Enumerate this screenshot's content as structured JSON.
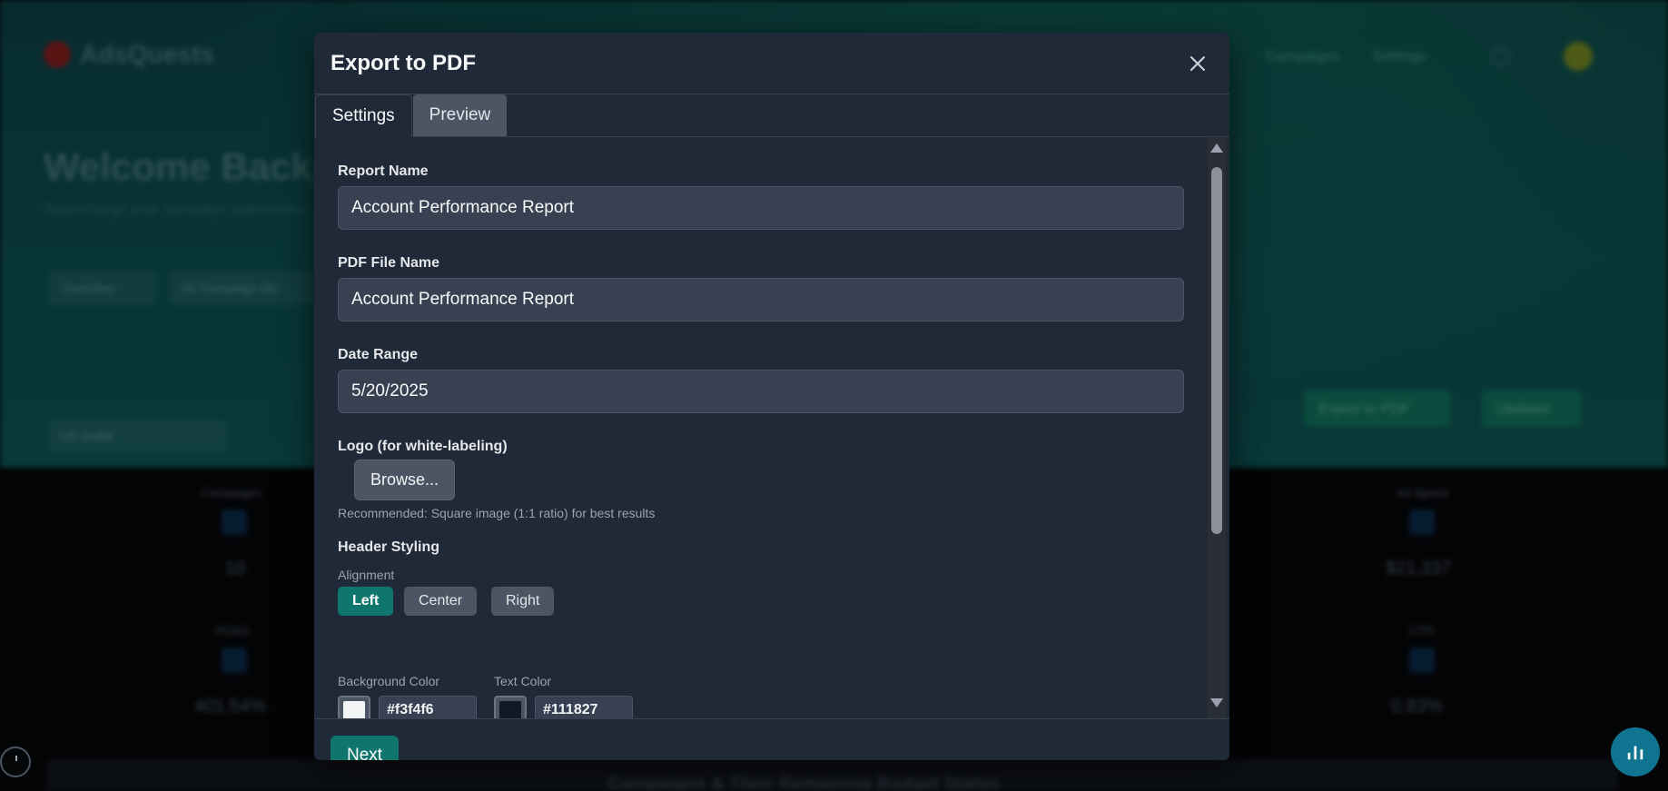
{
  "background": {
    "app_name": "AdsQuests",
    "nav": [
      "Campaigns",
      "Settings"
    ],
    "welcome": "Welcome Back,",
    "subtitle": "Supercharge your campaign optimization",
    "pills": [
      "Overview",
      "All Campaign Ids"
    ],
    "buttons": [
      "Export to PDF",
      "Updates"
    ],
    "filter": "US Dollar",
    "stats": [
      {
        "label": "Campaigns",
        "value": "10"
      },
      {
        "label": "Ad Spend",
        "value": "$21,337"
      },
      {
        "label": "ROAS",
        "value": "401.54%"
      },
      {
        "label": "CTR",
        "value": "0.83%"
      }
    ],
    "section_title": "Campaigns & Their Remaining Budget Status"
  },
  "modal": {
    "title": "Export to PDF",
    "tabs": [
      {
        "label": "Settings",
        "active": true
      },
      {
        "label": "Preview",
        "active": false
      }
    ],
    "fields": {
      "report_name_label": "Report Name",
      "report_name_value": "Account Performance Report",
      "pdf_file_name_label": "PDF File Name",
      "pdf_file_name_value": "Account Performance Report",
      "date_range_label": "Date Range",
      "date_range_value": "5/20/2025",
      "logo_label": "Logo (for white-labeling)",
      "browse_label": "Browse...",
      "logo_hint": "Recommended: Square image (1:1 ratio) for best results"
    },
    "header_styling": {
      "title": "Header Styling",
      "alignment_label": "Alignment",
      "alignment_options": [
        "Left",
        "Center",
        "Right"
      ],
      "alignment_selected": "Left",
      "background_color_label": "Background Color",
      "background_color_value": "#f3f4f6",
      "text_color_label": "Text Color",
      "text_color_value": "#111827"
    },
    "next_label": "Next"
  },
  "colors": {
    "accent": "#0f766e",
    "modal_bg": "#1f2937",
    "input_bg": "#374151"
  },
  "icons": {
    "close": "close-icon",
    "chart": "bar-chart-icon"
  }
}
